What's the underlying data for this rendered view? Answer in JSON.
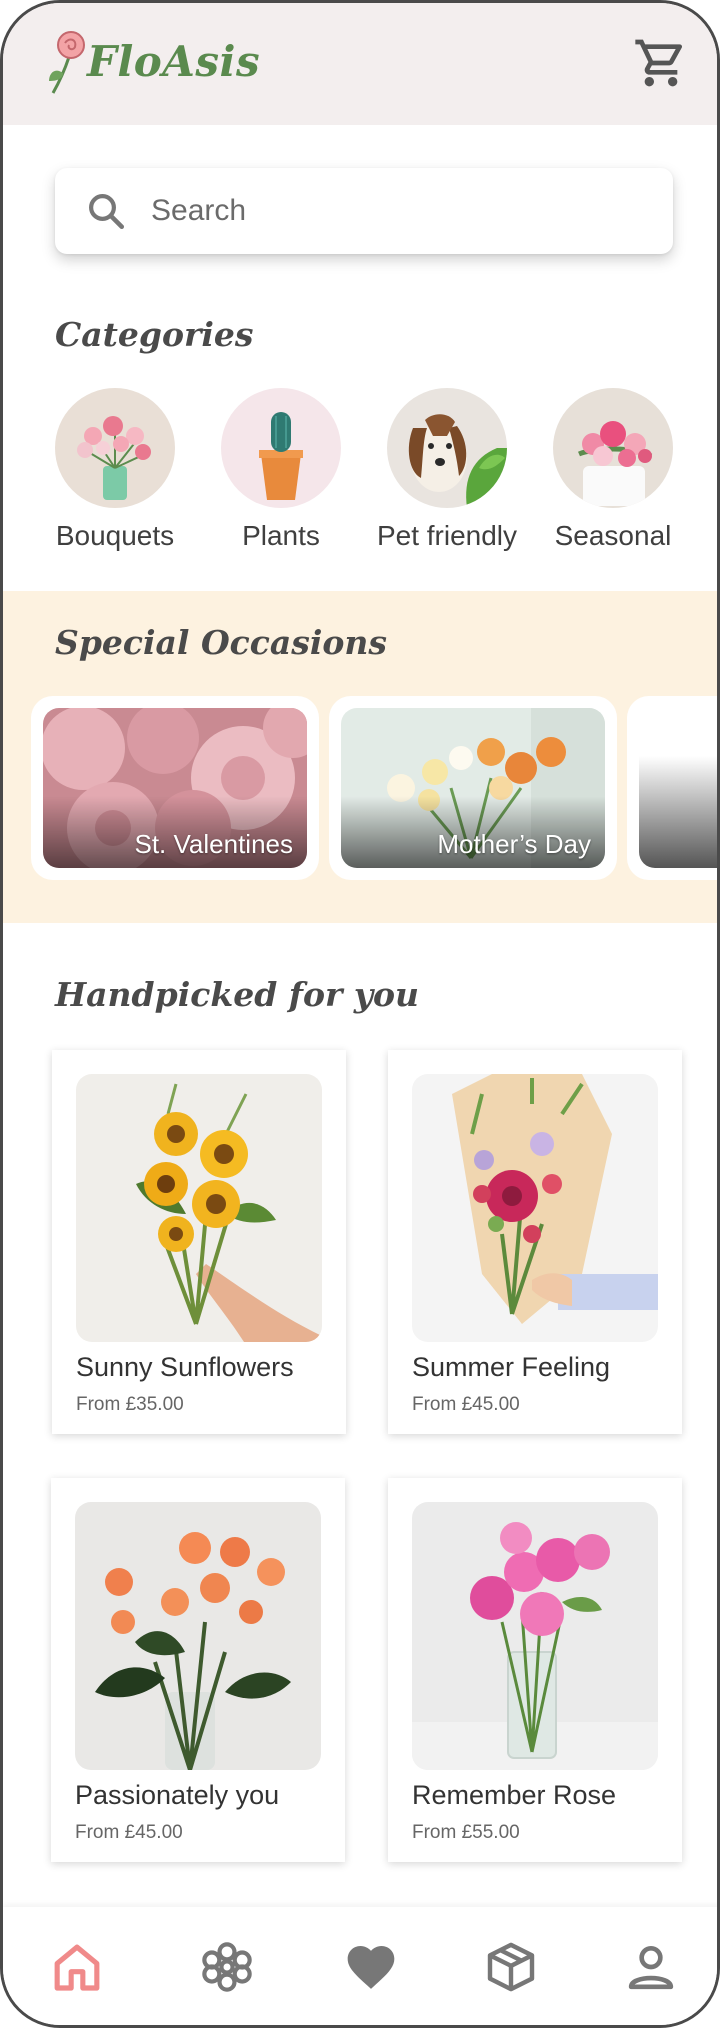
{
  "app": {
    "name": "FloAsis"
  },
  "search": {
    "placeholder": "Search"
  },
  "categories": {
    "title": "Categories",
    "items": [
      {
        "label": "Bouquets"
      },
      {
        "label": "Plants"
      },
      {
        "label": "Pet friendly"
      },
      {
        "label": "Seasonal"
      }
    ]
  },
  "occasions": {
    "title": "Special Occasions",
    "items": [
      {
        "label": "St. Valentines"
      },
      {
        "label": "Mother’s Day"
      },
      {
        "label": ""
      }
    ]
  },
  "handpicked": {
    "title": "Handpicked for you",
    "products": [
      {
        "name": "Sunny Sunflowers",
        "price": "From £35.00"
      },
      {
        "name": "Summer Feeling",
        "price": "From £45.00"
      },
      {
        "name": "Passionately you",
        "price": "From £45.00"
      },
      {
        "name": "Remember Rose",
        "price": "From £55.00"
      }
    ]
  },
  "nav": {
    "items": [
      "home-icon",
      "flower-icon",
      "heart-icon",
      "box-icon",
      "user-icon"
    ],
    "active": "home-icon"
  },
  "colors": {
    "brand_green": "#5a8a4e",
    "header_bg": "#f3eeee",
    "occasions_bg": "#fdf2e0",
    "active_nav": "#f08a8a",
    "inactive_nav": "#777777"
  }
}
